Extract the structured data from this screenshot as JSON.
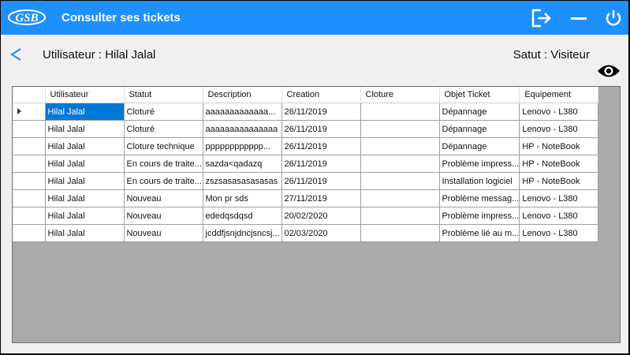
{
  "titlebar": {
    "logo_text": "GSB",
    "title": "Consulter ses tickets",
    "color": "#1e90ff",
    "icons": [
      "logout-icon",
      "minimize-icon",
      "power-icon"
    ]
  },
  "header": {
    "user": "Utilisateur : Hilal Jalal",
    "status": "Satut : Visiteur",
    "back_icon": "chevron-left-icon",
    "view_icon": "eye-icon"
  },
  "grid": {
    "columns": [
      "Utilisateur",
      "Statut",
      "Description",
      "Creation",
      "Cloture",
      "Objet Ticket",
      "Equipement"
    ],
    "rows": [
      {
        "utilisateur": "Hilal Jalal",
        "statut": "Cloturé",
        "description": "aaaaaaaaaaaaa...",
        "creation": "26/11/2019",
        "cloture": "",
        "objet": "Dépannage",
        "equipement": "Lenovo - L380"
      },
      {
        "utilisateur": "Hilal Jalal",
        "statut": "Cloturé",
        "description": "aaaaaaaaaaaaaaa",
        "creation": "26/11/2019",
        "cloture": "",
        "objet": "Dépannage",
        "equipement": "Lenovo - L380"
      },
      {
        "utilisateur": "Hilal Jalal",
        "statut": "Cloture technique",
        "description": "pppppppppppp...",
        "creation": "26/11/2019",
        "cloture": "",
        "objet": "Dépannage",
        "equipement": "HP - NoteBook"
      },
      {
        "utilisateur": "Hilal Jalal",
        "statut": "En cours de traite...",
        "description": "sazda<qadazq",
        "creation": "26/11/2019",
        "cloture": "",
        "objet": "Problème impress...",
        "equipement": "HP - NoteBook"
      },
      {
        "utilisateur": "Hilal Jalal",
        "statut": "En cours de traite...",
        "description": "zszsasasasasasas",
        "creation": "26/11/2019",
        "cloture": "",
        "objet": "Installation logiciel",
        "equipement": "HP - NoteBook"
      },
      {
        "utilisateur": "Hilal Jalal",
        "statut": "Nouveau",
        "description": "Mon pr sds",
        "creation": "27/11/2019",
        "cloture": "",
        "objet": "Problème messag...",
        "equipement": "Lenovo - L380"
      },
      {
        "utilisateur": "Hilal Jalal",
        "statut": "Nouveau",
        "description": "ededqsdqsd",
        "creation": "20/02/2020",
        "cloture": "",
        "objet": "Problème impress...",
        "equipement": "Lenovo - L380"
      },
      {
        "utilisateur": "Hilal Jalal",
        "statut": "Nouveau",
        "description": "jcddfjsnjdncjsncsj...",
        "creation": "02/03/2020",
        "cloture": "",
        "objet": "Problème lié au m...",
        "equipement": "Lenovo - L380"
      }
    ],
    "selected_row": 0
  }
}
